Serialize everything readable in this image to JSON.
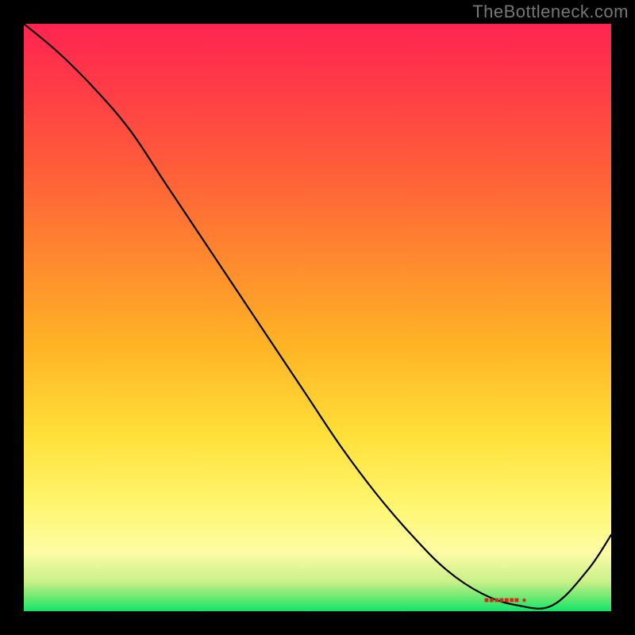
{
  "watermark": "TheBottleneck.com",
  "chart_data": {
    "type": "line",
    "title": "",
    "xlabel": "",
    "ylabel": "",
    "xlim": [
      0,
      100
    ],
    "ylim": [
      0,
      100
    ],
    "annotations": [
      {
        "text": "■■■■■■■ ●",
        "x": 82,
        "y": 1.5
      }
    ],
    "series": [
      {
        "name": "curve",
        "x": [
          0,
          6,
          12,
          18,
          24,
          30,
          36,
          42,
          48,
          54,
          60,
          66,
          72,
          78,
          84,
          90,
          96,
          100
        ],
        "y": [
          100,
          95,
          89,
          82,
          73,
          64,
          55,
          46,
          37,
          28,
          20,
          13,
          7,
          3,
          1,
          1,
          7,
          13
        ]
      }
    ],
    "gradient_stops": [
      {
        "offset": 0,
        "color": "#0FE46B"
      },
      {
        "offset": 0.02,
        "color": "#60E86F"
      },
      {
        "offset": 0.05,
        "color": "#C8F089"
      },
      {
        "offset": 0.1,
        "color": "#FDFCA5"
      },
      {
        "offset": 0.18,
        "color": "#FFF670"
      },
      {
        "offset": 0.3,
        "color": "#FFE039"
      },
      {
        "offset": 0.45,
        "color": "#FFB426"
      },
      {
        "offset": 0.6,
        "color": "#FF892F"
      },
      {
        "offset": 0.75,
        "color": "#FF5E39"
      },
      {
        "offset": 0.9,
        "color": "#FF3A48"
      },
      {
        "offset": 1.0,
        "color": "#FF2450"
      }
    ]
  }
}
